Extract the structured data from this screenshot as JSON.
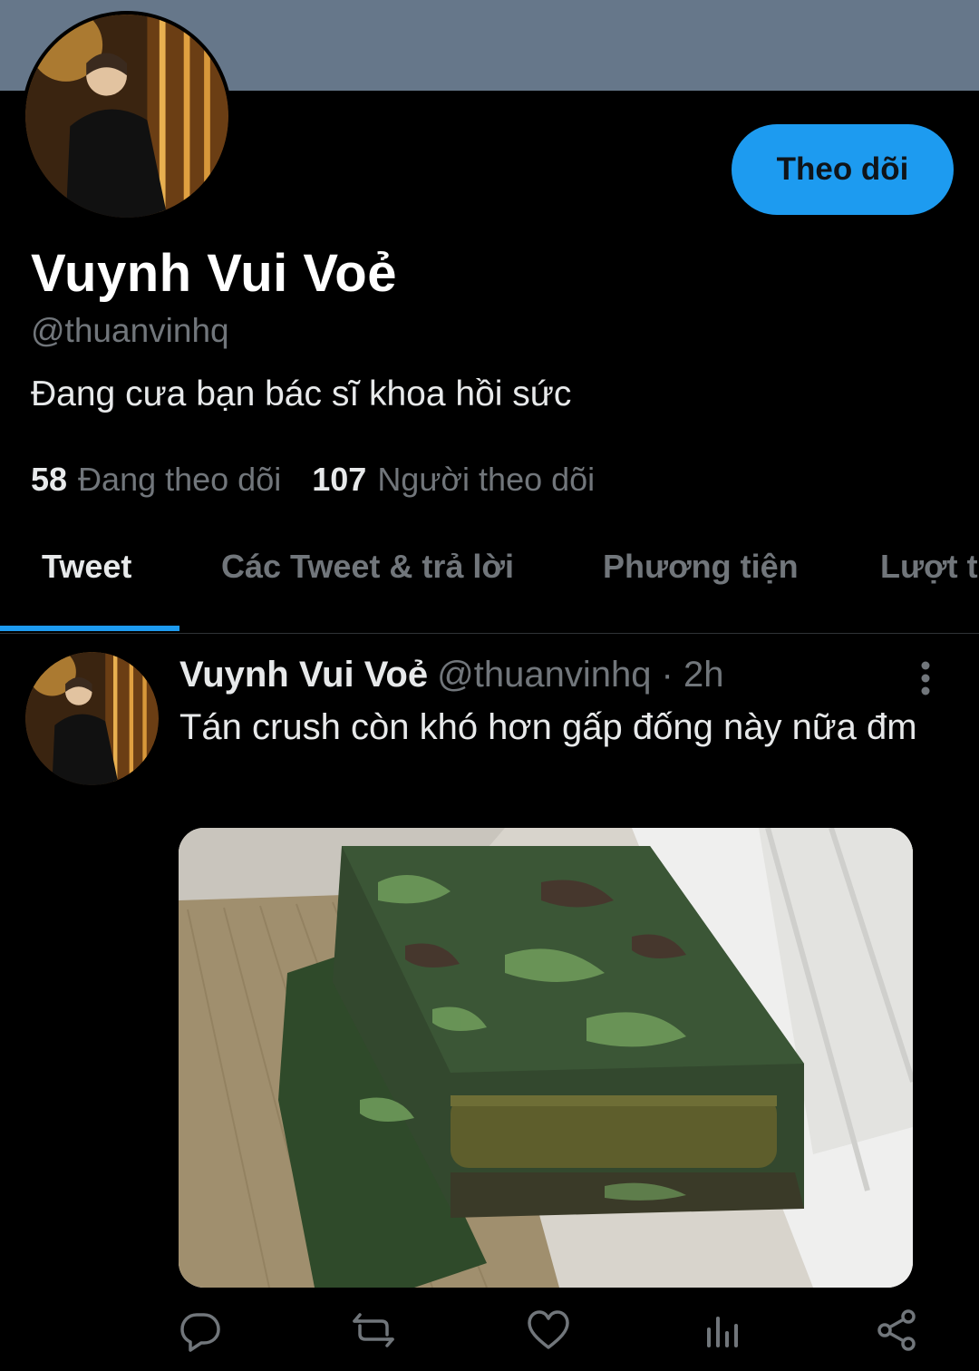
{
  "profile": {
    "display_name": "Vuynh Vui Voẻ",
    "handle": "@thuanvinhq",
    "bio": "Đang cưa bạn bác sĩ khoa hồi sức",
    "follow_button": "Theo dõi",
    "following_count": "58",
    "following_label": "Đang theo dõi",
    "followers_count": "107",
    "followers_label": "Người theo dõi"
  },
  "tabs": [
    {
      "label": "Tweet"
    },
    {
      "label": "Các Tweet & trả lời"
    },
    {
      "label": "Phương tiện"
    },
    {
      "label": "Lượt thích"
    }
  ],
  "tweet": {
    "name": "Vuynh Vui Voẻ",
    "meta": "@thuanvinhq · 2h",
    "text": "Tán crush còn khó hơn gấp đống này nữa đm"
  },
  "actions": [
    {
      "icon": "reply-icon"
    },
    {
      "icon": "retweet-icon"
    },
    {
      "icon": "like-icon"
    },
    {
      "icon": "analytics-icon"
    },
    {
      "icon": "share-icon"
    }
  ],
  "colors": {
    "banner": "#66778a",
    "accent": "#1d9bf0",
    "secondary_text": "#71767b",
    "background": "#000000"
  }
}
